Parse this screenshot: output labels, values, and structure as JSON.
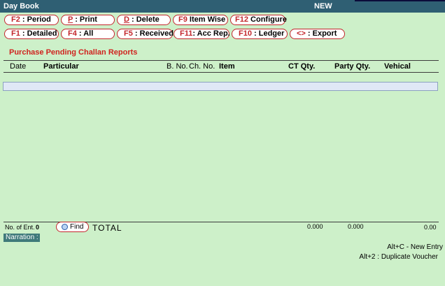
{
  "window": {
    "title": "Day Book",
    "status": "NEW"
  },
  "toolbar": {
    "row1": [
      {
        "key": "F2",
        "label": " : Period",
        "underline": false
      },
      {
        "key": "P",
        "label": " : Print",
        "underline": true
      },
      {
        "key": "D",
        "label": " : Delete",
        "underline": true
      },
      {
        "key": "F9",
        "label": " Item Wise",
        "underline": false
      },
      {
        "key": "F12",
        "label": " Configure",
        "underline": false
      }
    ],
    "row2": [
      {
        "key": "F1",
        "label": " : Detailed",
        "underline": false
      },
      {
        "key": "F4",
        "label": " : All",
        "underline": false
      },
      {
        "key": "F5",
        "label": " : Received",
        "underline": false
      },
      {
        "key": "F11",
        "label": ": Acc Rep.",
        "underline": false
      },
      {
        "key": "F10",
        "label": " : Ledger",
        "underline": false
      },
      {
        "key": "<>",
        "label": " : Export",
        "underline": false
      }
    ]
  },
  "report": {
    "title": "Purchase Pending Challan Reports",
    "columns": {
      "date": "Date",
      "particular": "Particular",
      "bno": "B. No.",
      "chno": "Ch. No.",
      "item": "Item",
      "ct_qty": "CT Qty.",
      "party_qty": "Party Qty.",
      "vehical": "Vehical"
    }
  },
  "footer": {
    "entries_label": "No. of Ent.",
    "entries_value": "0",
    "find_label": "Find",
    "total_label": "TOTAL",
    "ct_total": "0.000",
    "party_total": "0.000",
    "amount_total": "0.00"
  },
  "narration_label": "Narration :",
  "shortcuts": {
    "new_entry": "Alt+C  -   New Entry",
    "duplicate": "Alt+2 : Duplicate Voucher"
  },
  "colors": {
    "background": "#cdf0c9",
    "titlebar": "#2f5f73",
    "accent_red": "#c2262b",
    "report_title": "#d0231f",
    "narration_bg": "#3f7a7a"
  }
}
